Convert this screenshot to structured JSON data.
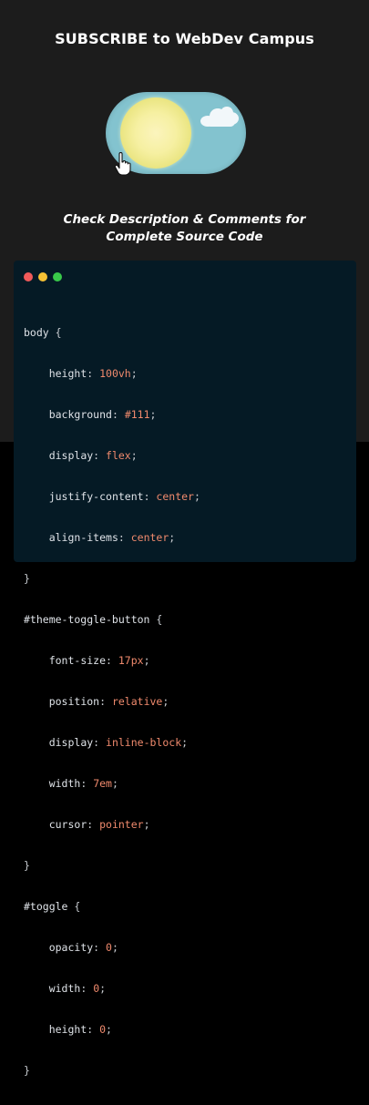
{
  "header": {
    "title": "SUBSCRIBE to WebDev Campus"
  },
  "subtitle": {
    "line1": "Check Description & Comments for",
    "line2": "Complete Source Code"
  },
  "colors": {
    "toggle_bg": "#83c3cf",
    "sun": "#f6f0a2",
    "code_bg": "#051a25",
    "code_value": "#f08a6d"
  },
  "icons": {
    "cursor": "hand-pointer-icon",
    "window_controls": [
      "close-dot-icon",
      "minimize-dot-icon",
      "maximize-dot-icon"
    ]
  },
  "code": {
    "lines": [
      {
        "sel": "body",
        "open": " {"
      },
      {
        "prop": "height",
        "val": "100vh"
      },
      {
        "prop": "background",
        "val": "#111"
      },
      {
        "prop": "display",
        "val": "flex"
      },
      {
        "prop": "justify-content",
        "val": "center"
      },
      {
        "prop": "align-items",
        "val": "center"
      },
      {
        "close": "}"
      },
      {
        "sel": "#theme-toggle-button",
        "open": " {"
      },
      {
        "prop": "font-size",
        "val": "17px"
      },
      {
        "prop": "position",
        "val": "relative"
      },
      {
        "prop": "display",
        "val": "inline-block"
      },
      {
        "prop": "width",
        "val": "7em"
      },
      {
        "prop": "cursor",
        "val": "pointer"
      },
      {
        "close": "}"
      },
      {
        "sel": "#toggle",
        "open": " {"
      },
      {
        "prop": "opacity",
        "val": "0"
      },
      {
        "prop": "width",
        "val": "0"
      },
      {
        "prop": "height",
        "val": "0"
      },
      {
        "close": "}"
      }
    ]
  }
}
